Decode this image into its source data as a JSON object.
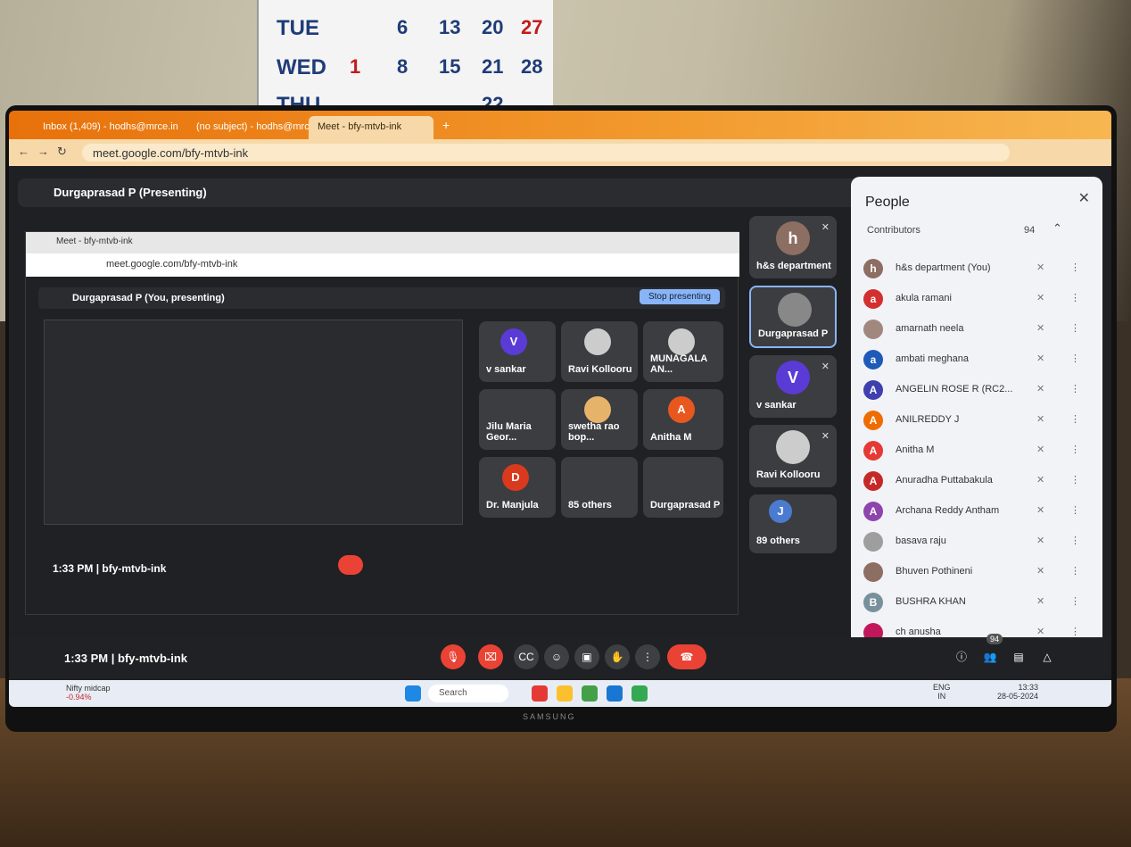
{
  "calendar": {
    "rows": [
      {
        "day": "TUE",
        "nums": [
          "6",
          "13",
          "20",
          "27"
        ]
      },
      {
        "day": "WED",
        "nums": [
          "1",
          "8",
          "15",
          "21",
          "28"
        ]
      },
      {
        "day": "THU",
        "nums": [
          "22"
        ]
      }
    ]
  },
  "browser": {
    "tabs": [
      "Inbox (1,409) - hodhs@mrce.in",
      "(no subject) - hodhs@mrce.in",
      "Meet - bfy-mtvb-ink"
    ],
    "url": "meet.google.com/bfy-mtvb-ink"
  },
  "meet": {
    "presenter_bar": "Durgaprasad P (Presenting)",
    "inner_presenter_bar": "Durgaprasad P (You, presenting)",
    "stop_presenting": "Stop presenting",
    "inner_url": "meet.google.com/bfy-mtvb-ink",
    "inner_tab": "Meet - bfy-mtvb-ink",
    "inner_time": "1:33 PM",
    "inner_code": "bfy-mtvb-ink",
    "inner_tiles": [
      {
        "name": "v sankar",
        "initial": "V",
        "color": "#5b3bd6"
      },
      {
        "name": "Ravi Kollooru",
        "initial": "",
        "color": "#ccc"
      },
      {
        "name": "MUNAGALA AN...",
        "initial": "",
        "color": "#ccc"
      },
      {
        "name": "Jilu Maria Geor...",
        "initial": "",
        "color": "#555"
      },
      {
        "name": "swetha rao bop...",
        "initial": "",
        "color": "#e6b36a"
      },
      {
        "name": "Anitha M",
        "initial": "A",
        "color": "#e8581e"
      },
      {
        "name": "Dr. Manjula",
        "initial": "D",
        "color": "#d93a1e"
      },
      {
        "name": "85 others",
        "initial": "",
        "color": "#888"
      },
      {
        "name": "Durgaprasad P",
        "initial": "",
        "color": "#888"
      }
    ],
    "side_tiles": [
      {
        "name": "h&s department",
        "initial": "h",
        "color": "#8d6e63"
      },
      {
        "name": "Durgaprasad P",
        "initial": "",
        "color": "#888"
      },
      {
        "name": "v sankar",
        "initial": "V",
        "color": "#5b3bd6"
      },
      {
        "name": "Ravi Kollooru",
        "initial": "",
        "color": "#ccc"
      },
      {
        "name": "89 others",
        "initial": "J",
        "color": "#4a7bd0"
      }
    ],
    "time": "1:33 PM",
    "code": "bfy-mtvb-ink",
    "participant_count": "94"
  },
  "people": {
    "title": "People",
    "section": "Contributors",
    "count": "94",
    "list": [
      {
        "name": "h&s department (You)",
        "initial": "h",
        "color": "#8d6e63"
      },
      {
        "name": "akula ramani",
        "initial": "a",
        "color": "#d32f2f"
      },
      {
        "name": "amarnath neela",
        "initial": "",
        "color": "#a1887f"
      },
      {
        "name": "ambati meghana",
        "initial": "a",
        "color": "#1e5bb8"
      },
      {
        "name": "ANGELIN ROSE R (RC2...",
        "initial": "A",
        "color": "#3f3fb0"
      },
      {
        "name": "ANILREDDY J",
        "initial": "A",
        "color": "#ef6c00"
      },
      {
        "name": "Anitha M",
        "initial": "A",
        "color": "#e53935"
      },
      {
        "name": "Anuradha Puttabakula",
        "initial": "A",
        "color": "#c62828"
      },
      {
        "name": "Archana Reddy Antham",
        "initial": "A",
        "color": "#8e44ad"
      },
      {
        "name": "basava raju",
        "initial": "",
        "color": "#9e9e9e"
      },
      {
        "name": "Bhuven Pothineni",
        "initial": "",
        "color": "#8d6e63"
      },
      {
        "name": "BUSHRA KHAN",
        "initial": "B",
        "color": "#78909c"
      },
      {
        "name": "ch anusha",
        "initial": "",
        "color": "#c2185b"
      }
    ]
  },
  "taskbar": {
    "stock": "Nifty midcap",
    "stock_change": "-0.94%",
    "search": "Search",
    "lang": "ENG",
    "lang2": "IN",
    "clock_time": "13:33",
    "clock_date": "28-05-2024"
  },
  "monitor_brand": "SAMSUNG"
}
